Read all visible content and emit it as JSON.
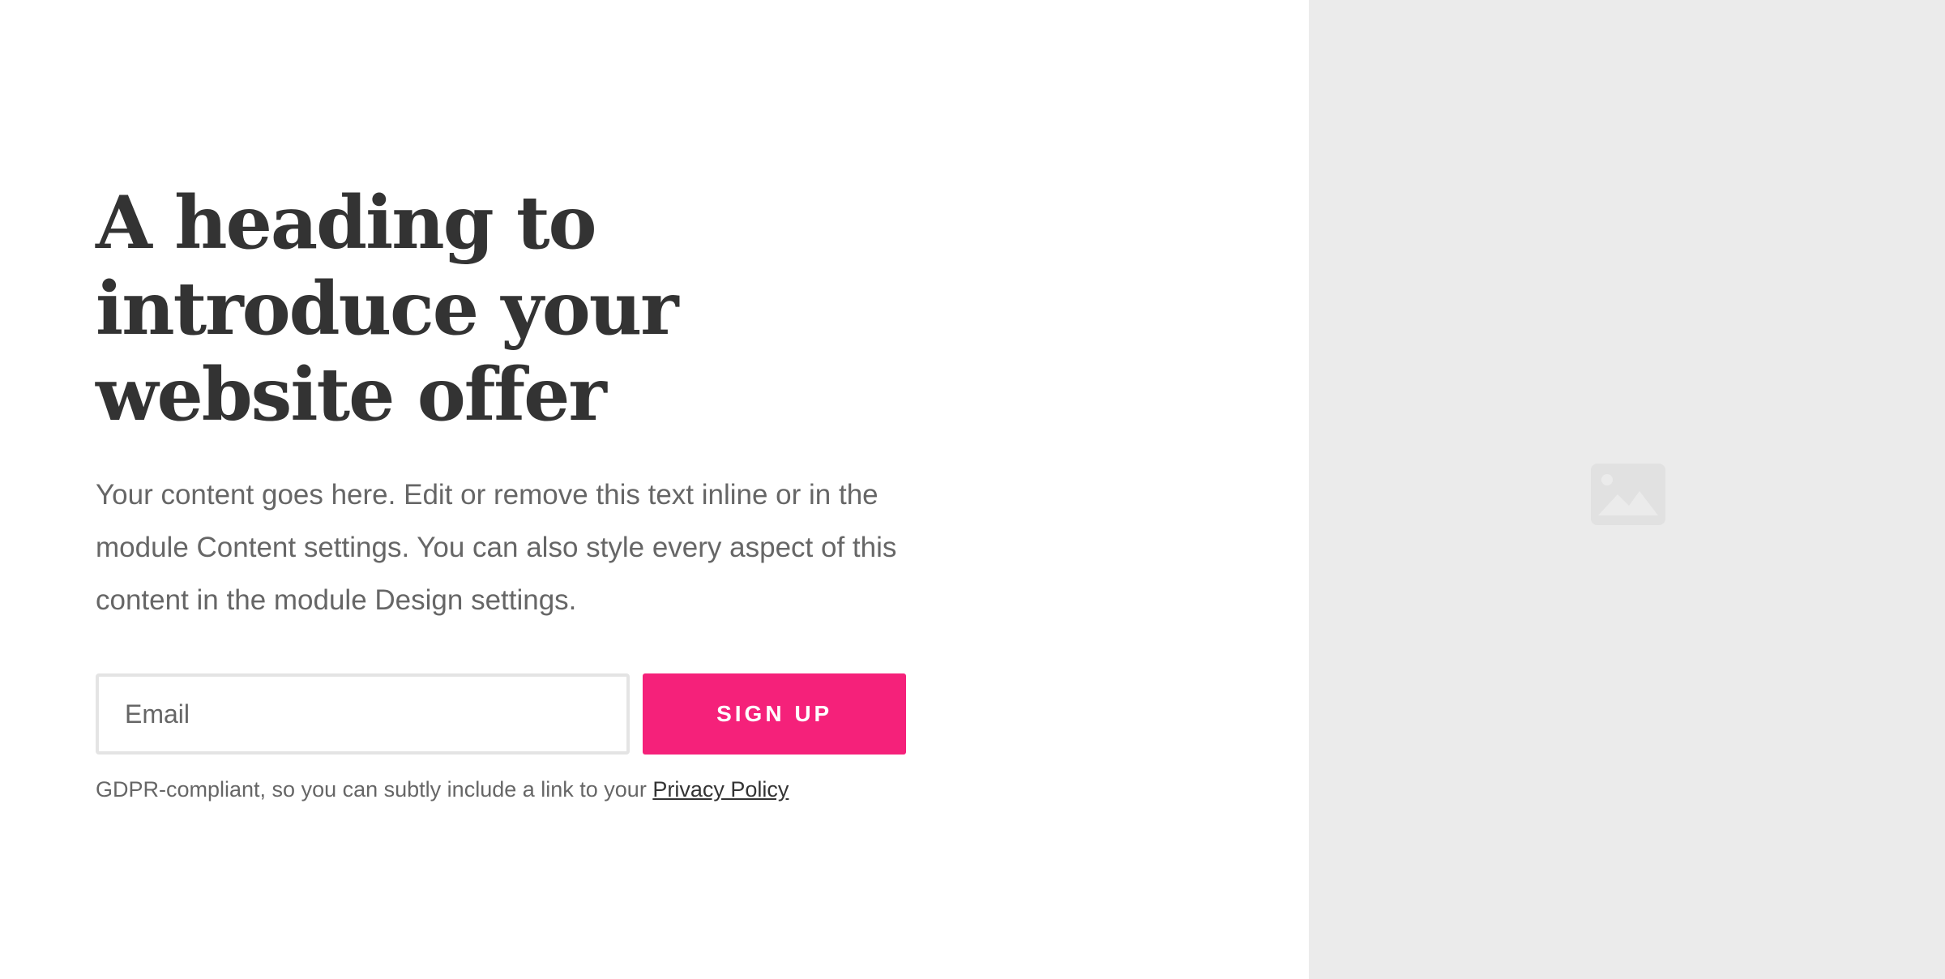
{
  "hero": {
    "heading": "A heading to introduce your website offer",
    "body": "Your content goes here. Edit or remove this text inline or in the module Content settings. You can also style every aspect of this content in the module Design settings."
  },
  "form": {
    "email_placeholder": "Email",
    "email_value": "",
    "submit_label": "SIGN UP"
  },
  "gdpr": {
    "text": "GDPR-compliant, so you can subtly include a link to your ",
    "link_label": "Privacy Policy"
  },
  "media": {
    "icon": "image-placeholder-icon"
  },
  "colors": {
    "accent": "#f5217a",
    "heading": "#333333",
    "body": "#666666",
    "media_background": "#ebebeb"
  }
}
